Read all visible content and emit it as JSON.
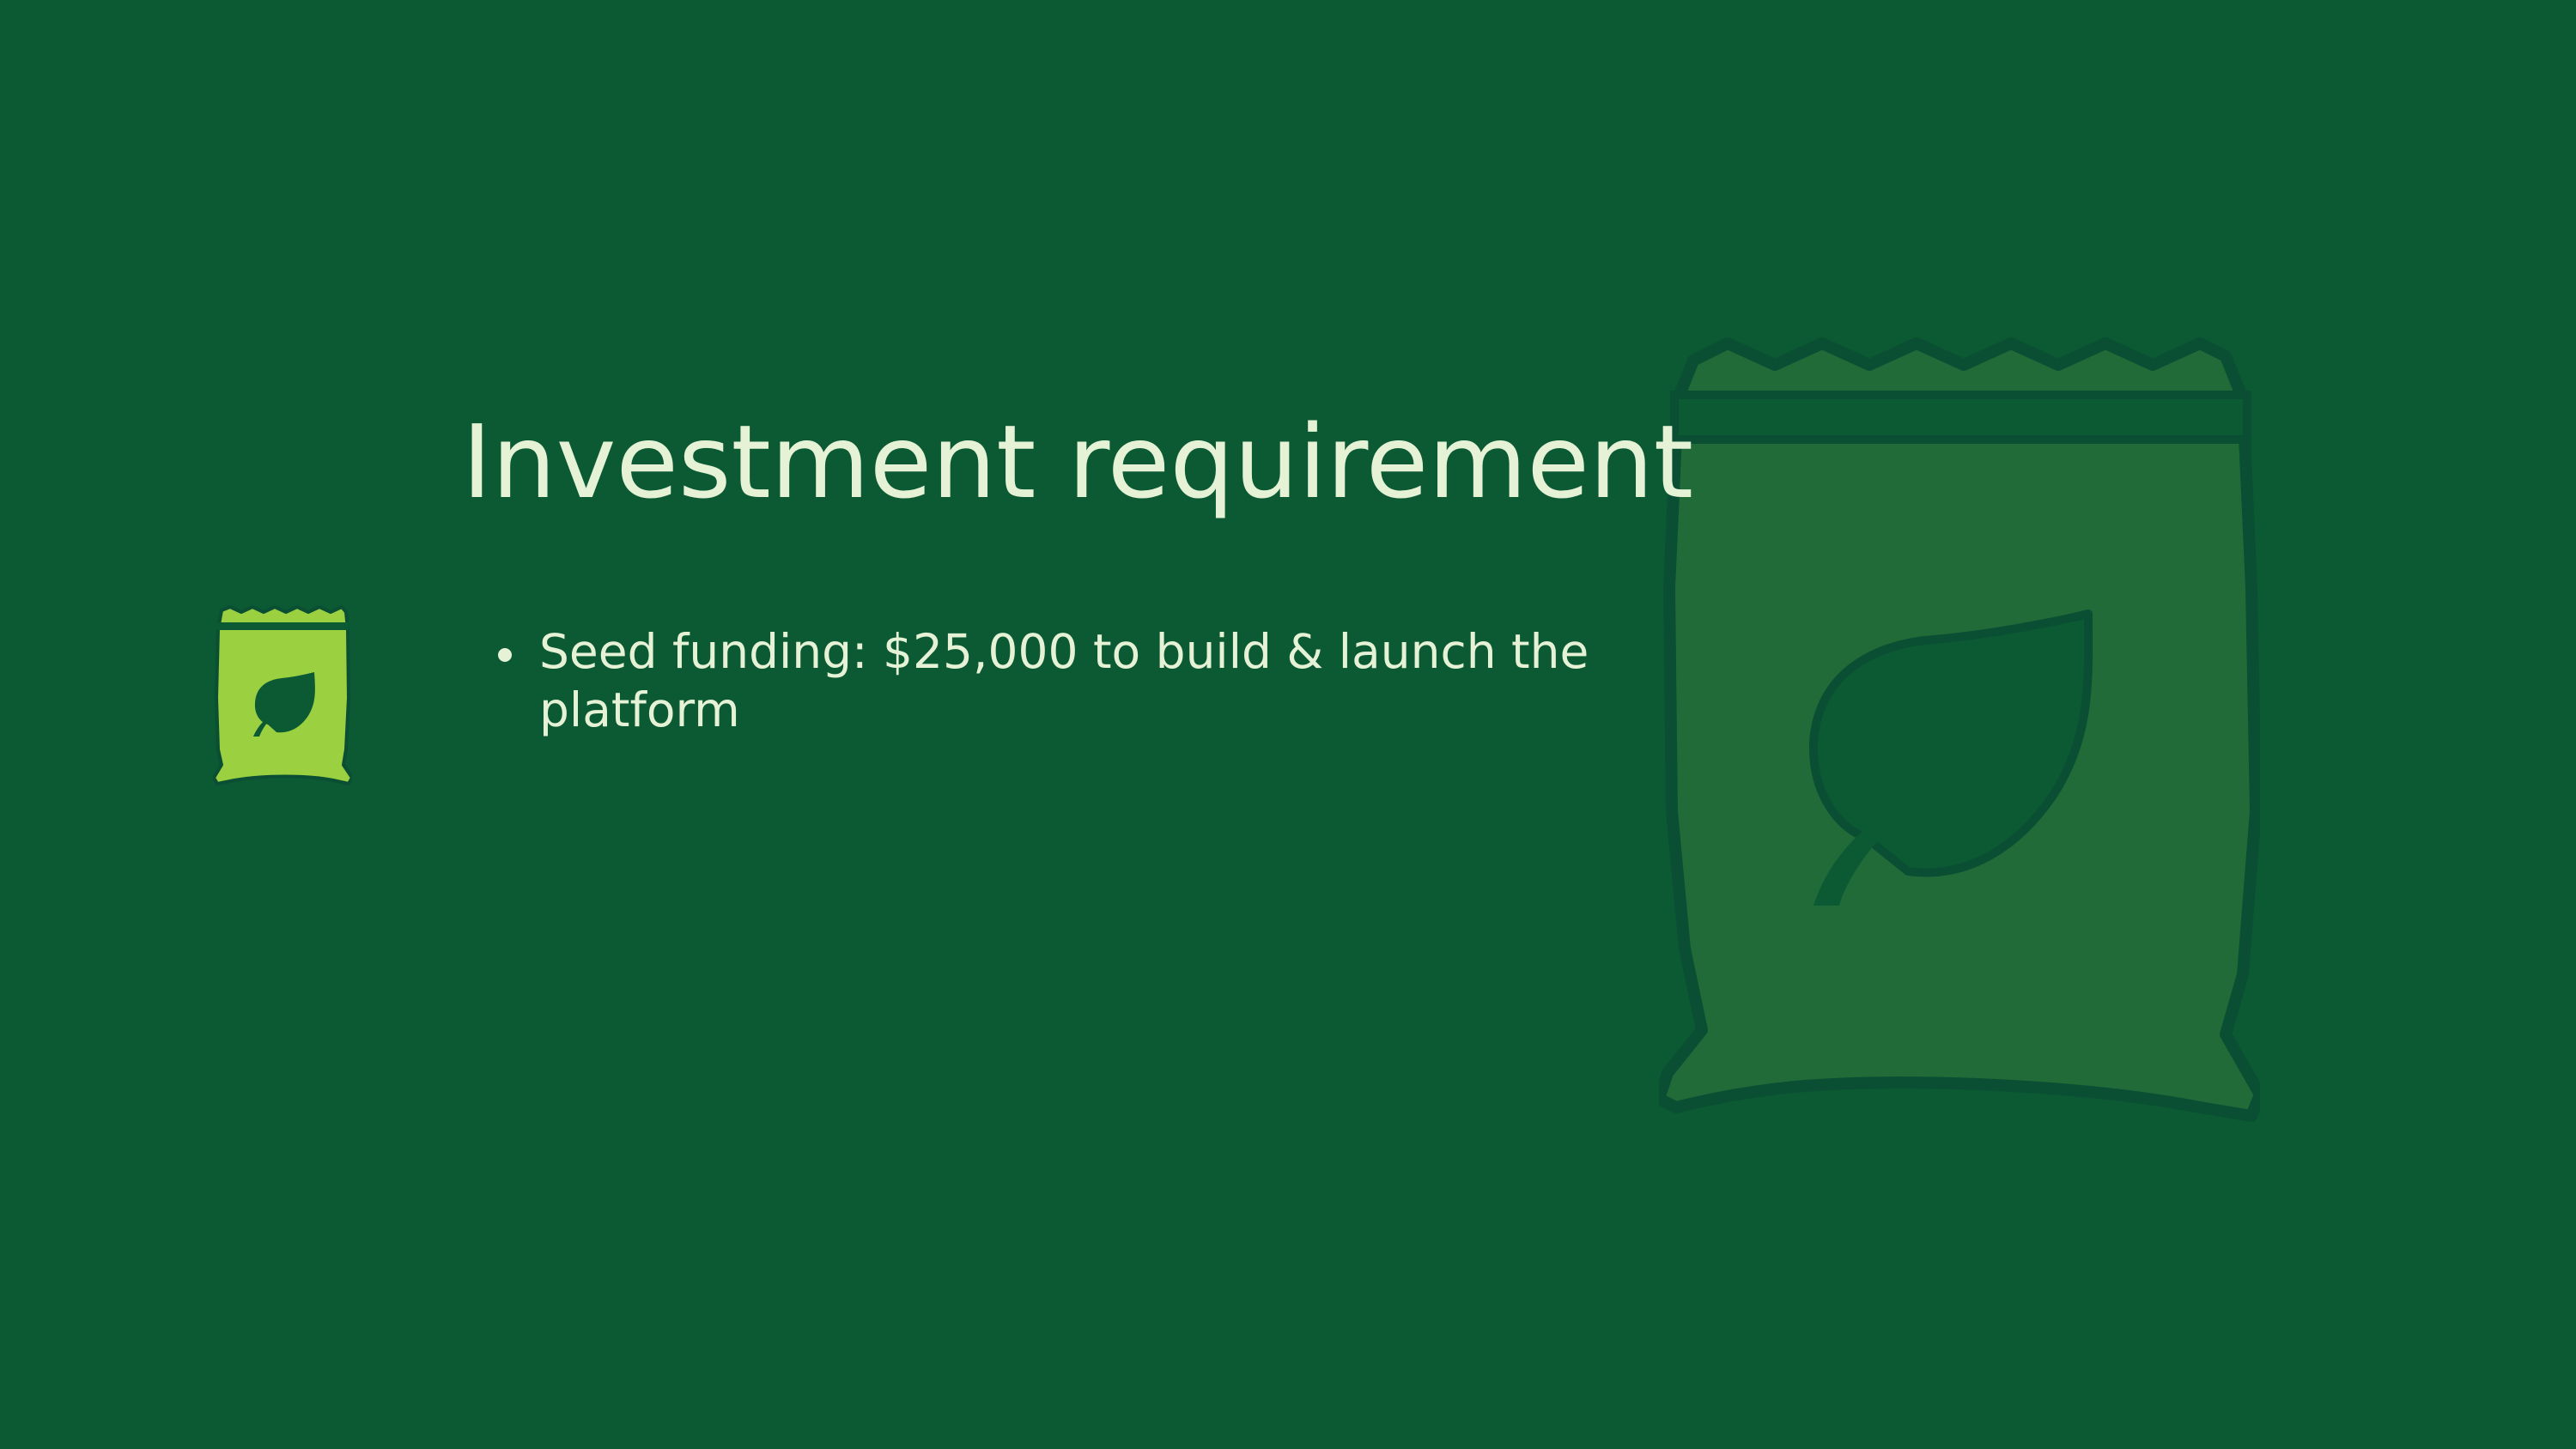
{
  "slide": {
    "title": "Investment requirement",
    "bullets": [
      {
        "text": "Seed funding: $25,000 to build & launch the platform"
      }
    ],
    "icons": {
      "decorative_large": "seed-bag-leaf-icon",
      "decorative_small": "seed-bag-leaf-icon"
    },
    "colors": {
      "background": "#0b5a33",
      "text": "#e6f2d6",
      "small_icon_fill": "#9bd041",
      "large_icon_fill": "#216b39",
      "icon_outline": "#0a4f33"
    }
  }
}
